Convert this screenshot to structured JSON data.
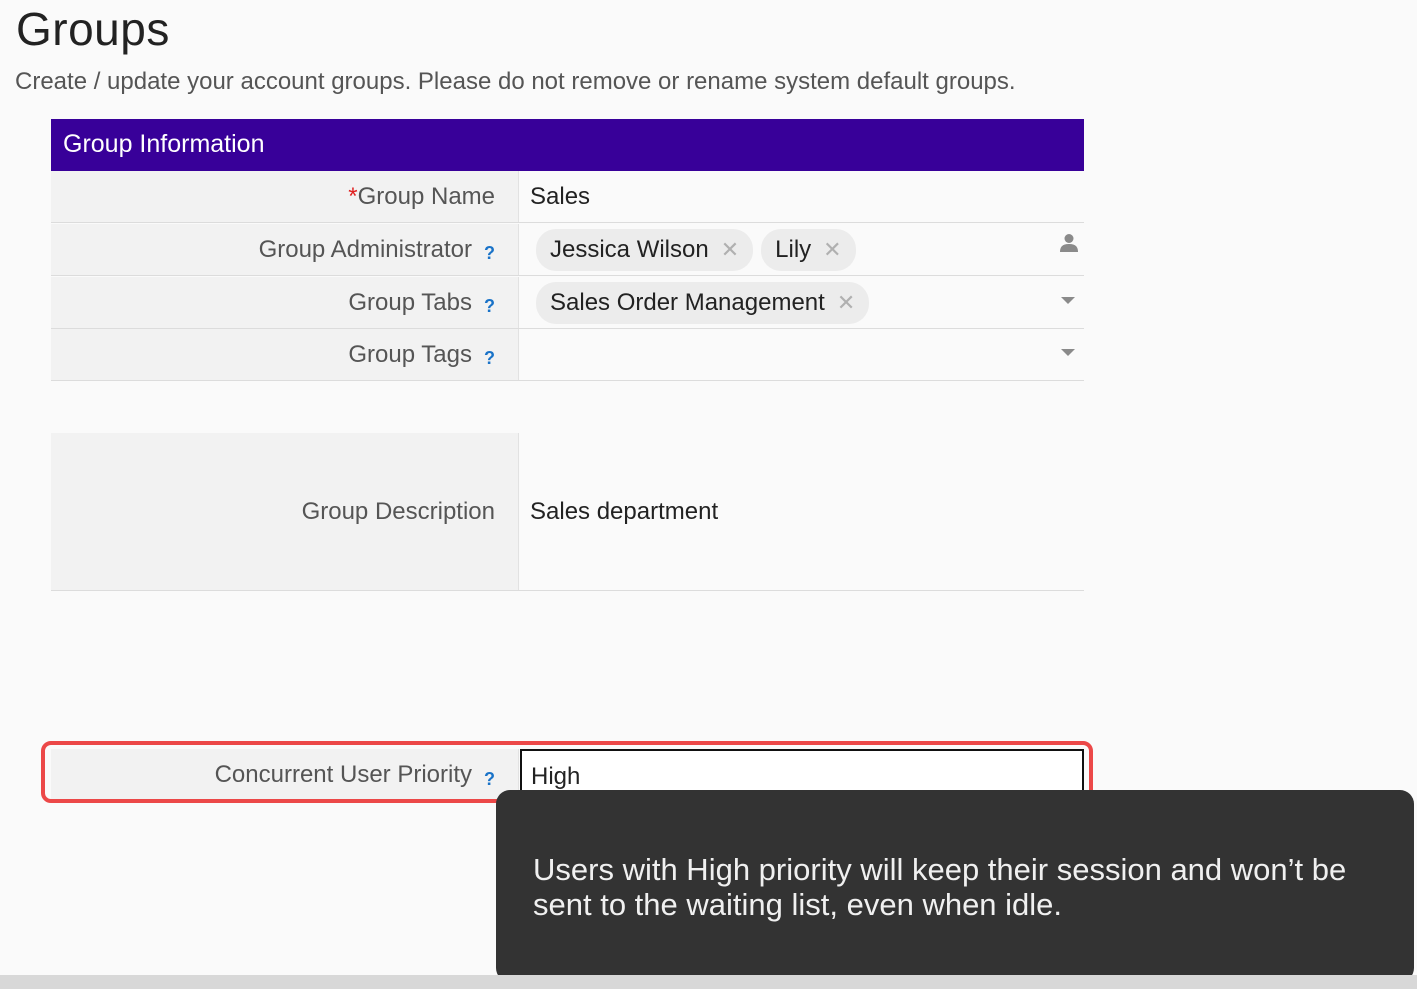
{
  "page": {
    "title": "Groups",
    "subtitle": "Create / update your account groups. Please do not remove or rename system default groups."
  },
  "section": {
    "header": "Group Information"
  },
  "fields": {
    "group_name": {
      "required_mark": "*",
      "label": "Group Name",
      "value": "Sales"
    },
    "group_administrator": {
      "label": "Group Administrator",
      "help": "?",
      "chips": [
        "Jessica Wilson",
        "Lily"
      ],
      "icon": "user-icon"
    },
    "group_tabs": {
      "label": "Group Tabs",
      "help": "?",
      "chips": [
        "Sales Order Management"
      ],
      "icon": "chevron-down-icon"
    },
    "group_tags": {
      "label": "Group Tags",
      "help": "?",
      "icon": "chevron-down-icon"
    },
    "group_description": {
      "label": "Group Description",
      "value": "Sales department"
    },
    "concurrent_user_priority": {
      "label": "Concurrent User Priority",
      "help": "?",
      "value": "High"
    }
  },
  "chip_remove_glyph": "✕",
  "tooltip": {
    "text": "Users with High priority will keep their session and won’t be sent to the waiting list, even when idle."
  },
  "colors": {
    "header_bg": "#380099",
    "highlight": "#ec4848",
    "tooltip_bg": "#333333",
    "help": "#1a73c8"
  }
}
